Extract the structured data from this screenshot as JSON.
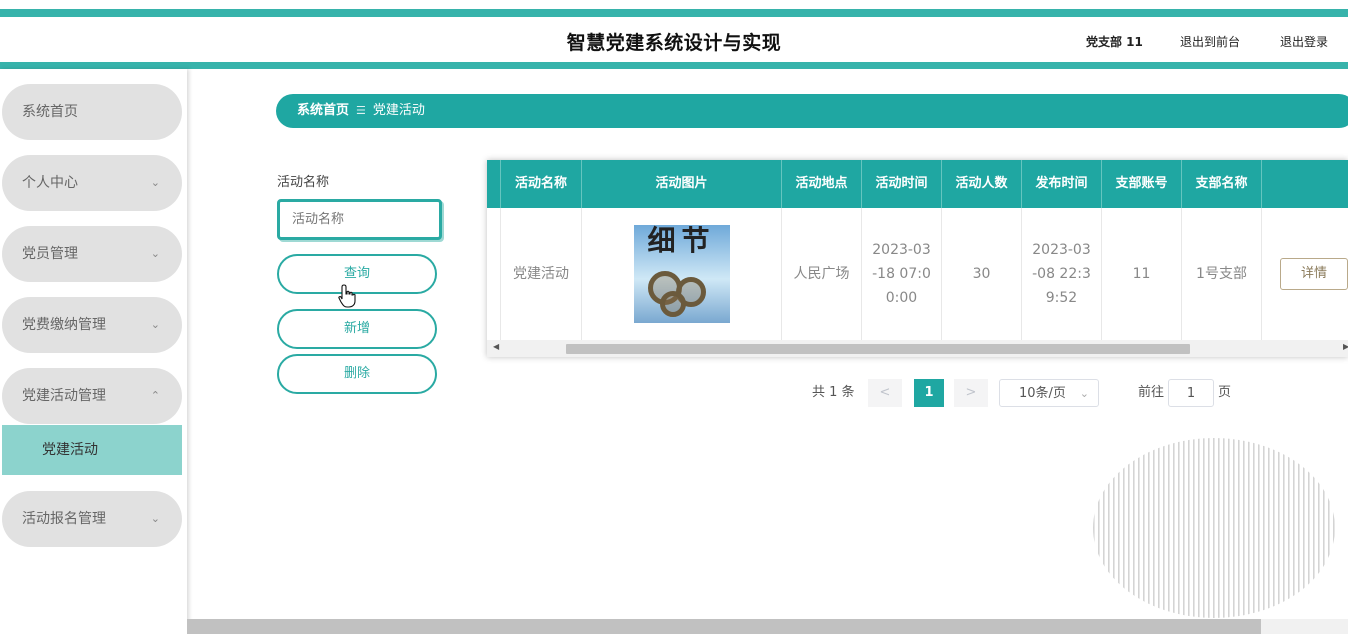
{
  "header": {
    "title": "智慧党建系统设计与实现",
    "user": "党支部 11",
    "exit_front": "退出到前台",
    "logout": "退出登录"
  },
  "sidebar": {
    "items": [
      {
        "label": "系统首页",
        "chevron": ""
      },
      {
        "label": "个人中心",
        "chevron": "⌄"
      },
      {
        "label": "党员管理",
        "chevron": "⌄"
      },
      {
        "label": "党费缴纳管理",
        "chevron": "⌄"
      },
      {
        "label": "党建活动管理",
        "chevron": "⌃"
      },
      {
        "label": "活动报名管理",
        "chevron": "⌄"
      }
    ],
    "active_sub": "党建活动"
  },
  "breadcrumb": {
    "home": "系统首页",
    "sep": "☰",
    "current": "党建活动"
  },
  "search": {
    "label": "活动名称",
    "placeholder": "活动名称",
    "query_btn": "查询",
    "add_btn": "新增",
    "delete_btn": "删除"
  },
  "table": {
    "columns": [
      "活动名称",
      "活动图片",
      "活动地点",
      "活动时间",
      "活动人数",
      "发布时间",
      "支部账号",
      "支部名称"
    ],
    "row": {
      "name": "党建活动",
      "image_text": "细节",
      "place": "人民广场",
      "time_l1": "2023-03",
      "time_l2": "-18 07:0",
      "time_l3": "0:00",
      "count": "30",
      "pub_l1": "2023-03",
      "pub_l2": "-08 22:3",
      "pub_l3": "9:52",
      "account": "11",
      "branch": "1号支部",
      "detail_btn": "详情"
    }
  },
  "pagination": {
    "total": "共 1 条",
    "prev": "<",
    "current": "1",
    "next": ">",
    "page_size": "10条/页",
    "goto_label": "前往",
    "goto_value": "1",
    "page_unit": "页"
  },
  "colors": {
    "accent": "#1fa7a2",
    "stripe": "#37b3ab",
    "sub_active": "#8cd3cd"
  }
}
